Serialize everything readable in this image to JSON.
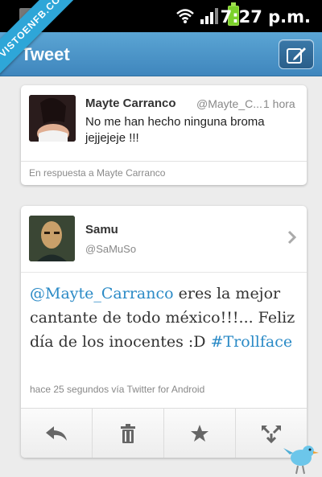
{
  "statusbar": {
    "time": "7:27 p.m."
  },
  "watermark": "VISTOENFB.COM",
  "header": {
    "title": "Tweet"
  },
  "reply_tweet": {
    "name": "Mayte Carranco",
    "handle": "@Mayte_C...",
    "time": "1 hora",
    "text": "No me han hecho ninguna broma jejjejeje !!!",
    "in_reply_to": "En respuesta a Mayte Carranco"
  },
  "main_tweet": {
    "name": "Samu",
    "handle": "@SaMuSo",
    "mention": "@Mayte_Carranco",
    "text_part1": " eres la mejor cantante de todo méxico!!!... Feliz día de los inocentes :D ",
    "hashtag": "#Trollface",
    "meta": "hace 25 segundos vía Twitter for Android"
  },
  "colors": {
    "accent": "#3f86bd",
    "link": "#2a8ac6"
  },
  "icons": [
    "wifi-icon",
    "signal-icon",
    "battery-icon",
    "compose-icon",
    "chevron-right-icon",
    "reply-icon",
    "delete-icon",
    "favorite-icon",
    "share-icon",
    "bird-icon"
  ]
}
